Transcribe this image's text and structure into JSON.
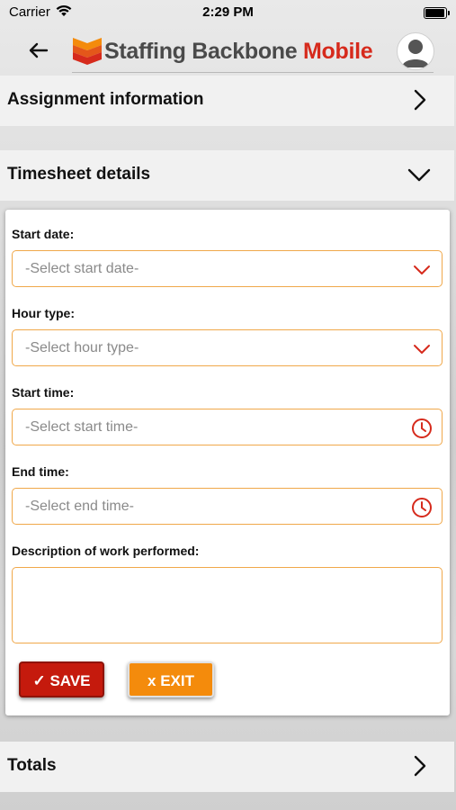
{
  "status_bar": {
    "carrier": "Carrier",
    "time": "2:29 PM"
  },
  "header": {
    "brand_main": "Staffing Backbone",
    "brand_accent": "Mobile"
  },
  "sections": {
    "assignment": {
      "title": "Assignment information",
      "icon": "chevron-right-icon"
    },
    "timesheet": {
      "title": "Timesheet details",
      "icon": "chevron-down-icon"
    },
    "totals": {
      "title": "Totals",
      "icon": "chevron-right-icon"
    }
  },
  "form": {
    "start_date": {
      "label": "Start date:",
      "placeholder": "-Select start date-"
    },
    "hour_type": {
      "label": "Hour type:",
      "placeholder": "-Select hour type-"
    },
    "start_time": {
      "label": "Start time:",
      "placeholder": "-Select start time-"
    },
    "end_time": {
      "label": "End time:",
      "placeholder": "-Select end time-"
    },
    "description": {
      "label": "Description of work performed:",
      "value": ""
    },
    "save_label": "✓ SAVE",
    "exit_label": "x EXIT"
  },
  "colors": {
    "accent_red": "#d62a1c",
    "field_border": "#f0a84a",
    "save_button": "#c51a0d",
    "exit_button": "#f48b0c"
  }
}
